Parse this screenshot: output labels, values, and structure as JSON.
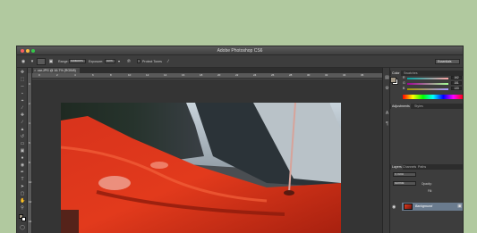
{
  "window": {
    "title": "Adobe Photoshop CS6",
    "traffic_lights": {
      "close": "#fc605c",
      "minimize": "#fdbc40",
      "zoom": "#34c84a"
    }
  },
  "options_bar": {
    "range_label": "Range:",
    "range_value": "Midtones",
    "exposure_label": "Exposure:",
    "exposure_value": "50%",
    "protect_tones_label": "Protect Tones",
    "workspace_value": "Essentials"
  },
  "document": {
    "tab_title": "car.JPG @ 16.7% (RGB/8)",
    "close_glyph": "×",
    "ruler_top_ticks": [
      "0",
      "2",
      "4",
      "6",
      "8",
      "10",
      "12",
      "14",
      "16",
      "18",
      "20",
      "22",
      "24",
      "26",
      "28",
      "30",
      "32",
      "34",
      "36"
    ],
    "ruler_left_ticks": [
      "0",
      "2",
      "4",
      "6",
      "8",
      "10",
      "12",
      "14"
    ]
  },
  "panels": {
    "color_tabs": [
      "Color",
      "Swatches"
    ],
    "color_sliders": [
      {
        "letter": "R",
        "value": "162",
        "colors": [
          "#00a4a4",
          "#ffa4a4"
        ]
      },
      {
        "letter": "G",
        "value": "151",
        "colors": [
          "#a20094",
          "#a2ff94"
        ]
      },
      {
        "letter": "B",
        "value": "133",
        "colors": [
          "#a29700",
          "#a297ff"
        ]
      }
    ],
    "adjust_tabs": [
      "Adjustments",
      "Styles"
    ],
    "layers_tabs": [
      "Layers",
      "Channels",
      "Paths"
    ],
    "layers_kind": "Kind",
    "blend_mode": "Normal",
    "opacity_label": "Opacity:",
    "fill_label": "Fill:",
    "layer_name": "Background"
  },
  "colors": {
    "foreground": "#a29785",
    "background": "#ffffff"
  }
}
